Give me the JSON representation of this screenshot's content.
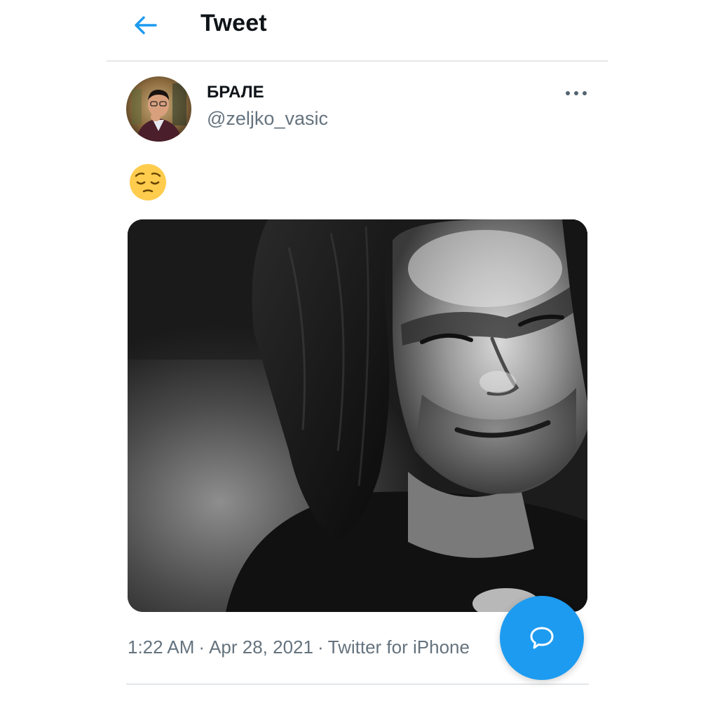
{
  "header": {
    "back_icon": "arrow-left-icon",
    "title": "Tweet"
  },
  "author": {
    "display_name": "БРАЛЕ",
    "handle": "@zeljko_vasic",
    "avatar_icon": "profile-photo"
  },
  "tweet": {
    "text_icon": "pensive-face-emoji",
    "media_description_icon": "black-and-white-photo"
  },
  "more_icon": "more-horizontal-icon",
  "meta": {
    "time": "1:22 AM",
    "separator": "·",
    "date": "Apr 28, 2021",
    "source": "Twitter for iPhone"
  },
  "fab": {
    "icon": "reply-bubble-icon"
  },
  "colors": {
    "accent": "#1d9bf0",
    "text_primary": "#0f1419",
    "text_secondary": "#65737e",
    "divider": "#e3e6e8",
    "emoji_yellow": "#ffcc4d"
  }
}
